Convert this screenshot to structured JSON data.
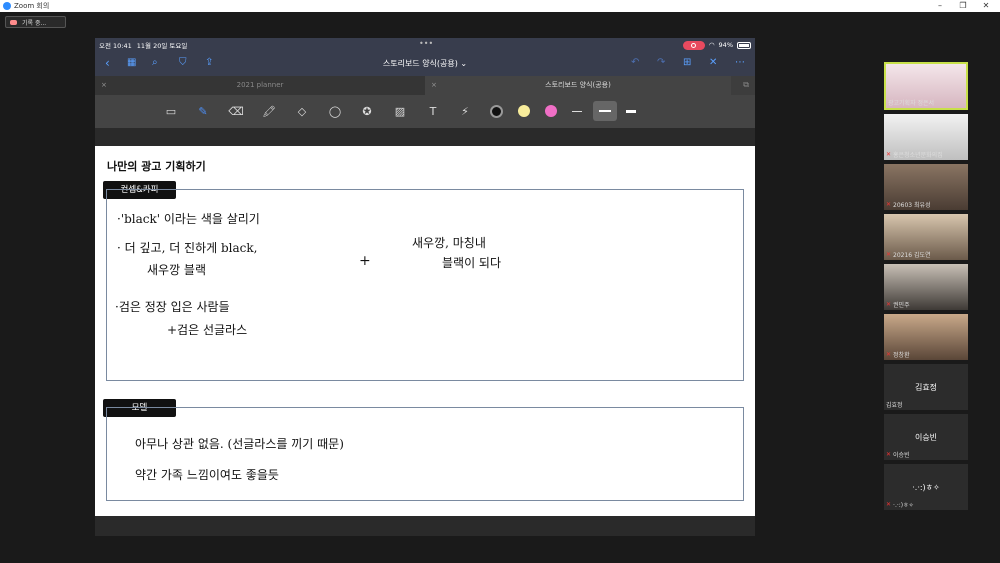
{
  "window": {
    "title": "Zoom 회의",
    "minimize": "–",
    "maximize": "❐",
    "close": "✕"
  },
  "recording": {
    "label": "기록 중..."
  },
  "ipad": {
    "time": "오전 10:41",
    "date": "11월 20일 토요일",
    "dots": "•••",
    "battery": "94%",
    "doc_title": "스토리보드 양식(공용) ⌄",
    "tabs": [
      "2021 planner",
      "스토리보드 양식(공용)"
    ],
    "tab_close": "×"
  },
  "page": {
    "title": "나만의 광고 기획하기",
    "section1": {
      "label": "컨셉&카피",
      "lines": [
        "·'black' 이라는   색을 살리기",
        "· 더 깊고, 더 진하게   black,",
        "새우깡 블랙",
        "+",
        "새우깡, 마칭내",
        "블랙이 되다",
        "·검은  정장   입은   사람들",
        "+검은 선글라스"
      ]
    },
    "section2": {
      "label": "모델",
      "lines": [
        "아무나  상관   없음. (선글라스를 끼기 때문)",
        "약간  가족  느낌이여도  좋을듯"
      ]
    }
  },
  "participants": [
    {
      "name": "광고기획자 정은서",
      "highlight": true
    },
    {
      "name": "홍은청소년문화의집"
    },
    {
      "name": "20603 최유성"
    },
    {
      "name": "20216 김도연"
    },
    {
      "name": "권민주"
    },
    {
      "name": "정창환"
    },
    {
      "name": "김효정",
      "big": "김효정"
    },
    {
      "name": "이승빈",
      "big": "이승빈"
    },
    {
      "name": "·.·:)ㅎ✧",
      "big": "·.·:)ㅎ✧"
    }
  ],
  "colors": {
    "accent": "#2d8cff",
    "highlight_border": "#c8e04a",
    "mic_muted": "#e33"
  }
}
